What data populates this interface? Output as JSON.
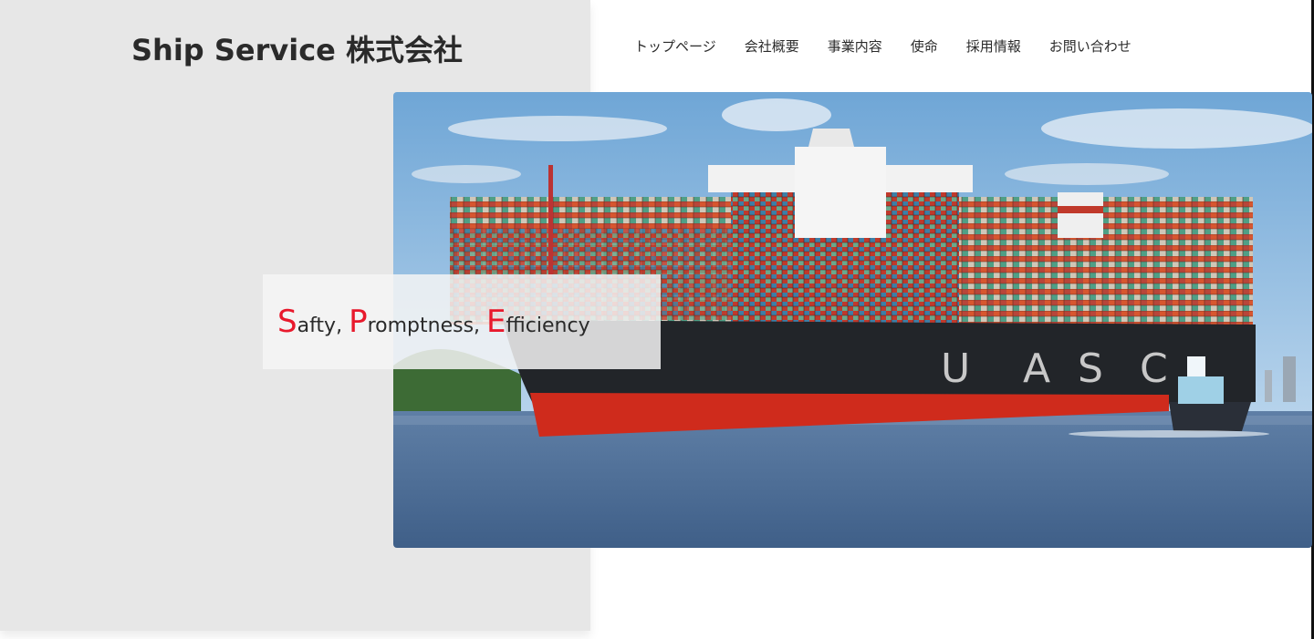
{
  "header": {
    "logo": "Ship Service 株式会社"
  },
  "nav": {
    "items": [
      {
        "label": "トップページ"
      },
      {
        "label": "会社概要"
      },
      {
        "label": "事業内容"
      },
      {
        "label": "使命"
      },
      {
        "label": "採用情報"
      },
      {
        "label": "お問い合わせ"
      }
    ]
  },
  "hero": {
    "ship_hull_text": [
      "U",
      "A",
      "S",
      "C"
    ],
    "image": "container-ship-photo"
  },
  "tagline": {
    "words": [
      {
        "initial": "S",
        "rest": "afty, "
      },
      {
        "initial": "P",
        "rest": "romptness, "
      },
      {
        "initial": "E",
        "rest": "fficiency"
      }
    ]
  },
  "colors": {
    "accent": "#e8192c",
    "panel": "#e7e7e7",
    "text": "#2a2a2a"
  }
}
